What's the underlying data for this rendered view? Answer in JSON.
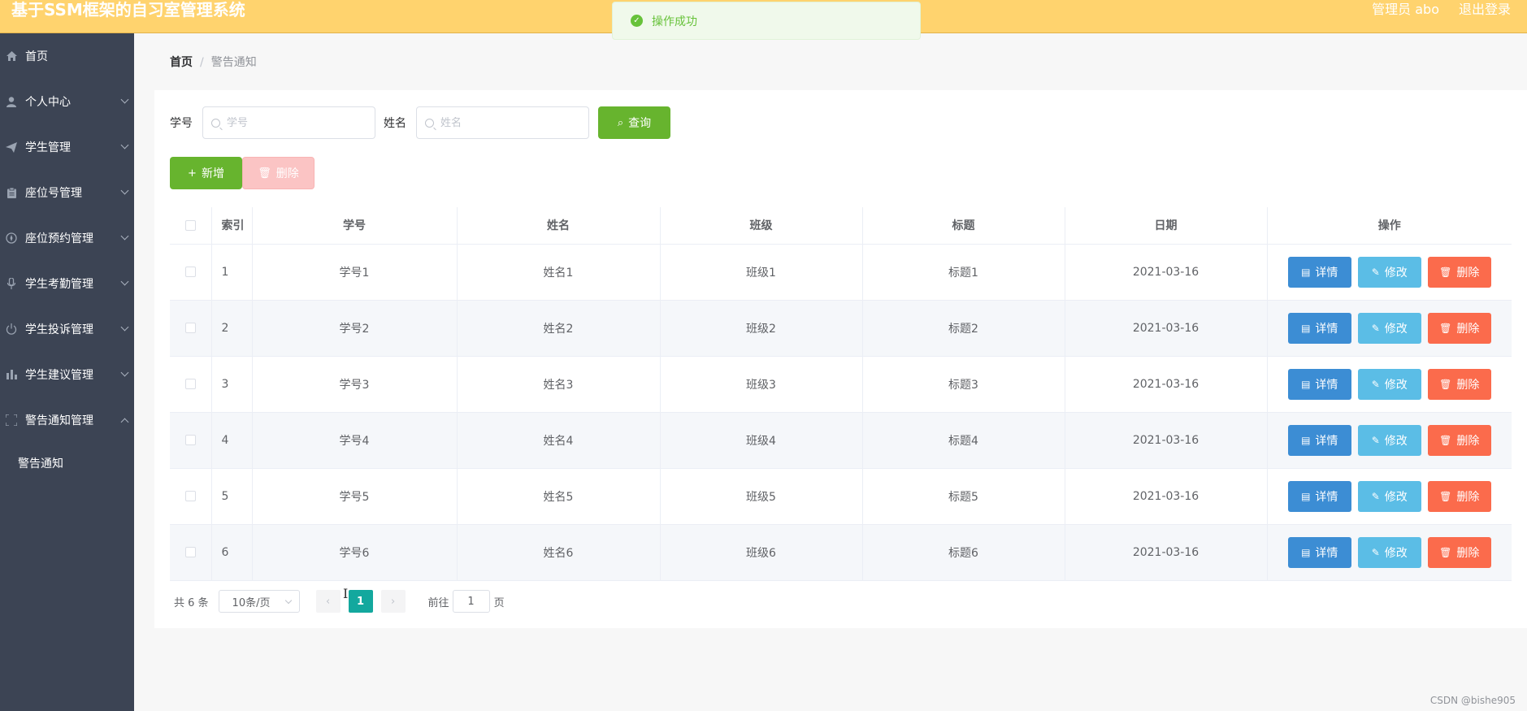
{
  "header": {
    "title": "基于SSM框架的自习室管理系统",
    "user": "管理员 abo",
    "logout": "退出登录"
  },
  "toast": {
    "message": "操作成功"
  },
  "sidebar": {
    "items": [
      {
        "label": "首页",
        "icon": "home-icon"
      },
      {
        "label": "个人中心",
        "icon": "user-icon"
      },
      {
        "label": "学生管理",
        "icon": "send-icon"
      },
      {
        "label": "座位号管理",
        "icon": "clipboard-icon"
      },
      {
        "label": "座位预约管理",
        "icon": "compass-icon"
      },
      {
        "label": "学生考勤管理",
        "icon": "microphone-icon"
      },
      {
        "label": "学生投诉管理",
        "icon": "power-icon"
      },
      {
        "label": "学生建议管理",
        "icon": "bar-chart-icon"
      },
      {
        "label": "警告通知管理",
        "icon": "fullscreen-icon"
      }
    ],
    "sub_item": "警告通知"
  },
  "breadcrumb": {
    "home": "首页",
    "separator": "/",
    "current": "警告通知"
  },
  "search": {
    "student_id_label": "学号",
    "student_id_placeholder": "学号",
    "name_label": "姓名",
    "name_placeholder": "姓名",
    "query_label": "查询"
  },
  "toolbar": {
    "add_label": "新增",
    "delete_label": "删除"
  },
  "table": {
    "columns": [
      "索引",
      "学号",
      "姓名",
      "班级",
      "标题",
      "日期",
      "操作"
    ],
    "rows": [
      [
        "1",
        "学号1",
        "姓名1",
        "班级1",
        "标题1",
        "2021-03-16"
      ],
      [
        "2",
        "学号2",
        "姓名2",
        "班级2",
        "标题2",
        "2021-03-16"
      ],
      [
        "3",
        "学号3",
        "姓名3",
        "班级3",
        "标题3",
        "2021-03-16"
      ],
      [
        "4",
        "学号4",
        "姓名4",
        "班级4",
        "标题4",
        "2021-03-16"
      ],
      [
        "5",
        "学号5",
        "姓名5",
        "班级5",
        "标题5",
        "2021-03-16"
      ],
      [
        "6",
        "学号6",
        "姓名6",
        "班级6",
        "标题6",
        "2021-03-16"
      ]
    ],
    "actions": {
      "detail": "详情",
      "edit": "修改",
      "delete": "删除"
    }
  },
  "pagination": {
    "total": "共 6 条",
    "page_size": "10条/页",
    "current_page": "1",
    "goto_label": "前往",
    "goto_value": "1",
    "page_suffix": "页"
  },
  "watermark": "CSDN @bishe905",
  "colors": {
    "header": "#ffd36e",
    "sidebar": "#3c4454",
    "primary_green": "#67b42e",
    "detail_blue": "#3c8dd4",
    "edit_blue": "#5bbde6",
    "delete_red": "#fb6b4c",
    "page_active": "#13a89e"
  }
}
